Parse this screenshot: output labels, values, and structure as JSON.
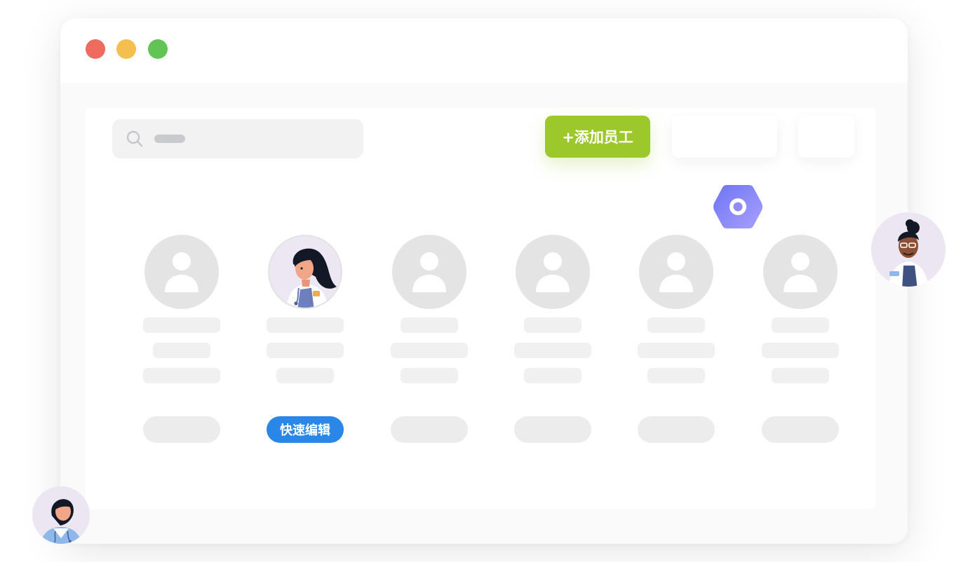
{
  "toolbar": {
    "add_employee_label": "+添加员工"
  },
  "employees": [
    {
      "has_photo": false,
      "button_label": ""
    },
    {
      "has_photo": true,
      "button_label": "快速编辑"
    },
    {
      "has_photo": false,
      "button_label": ""
    },
    {
      "has_photo": false,
      "button_label": ""
    },
    {
      "has_photo": false,
      "button_label": ""
    },
    {
      "has_photo": false,
      "button_label": ""
    }
  ],
  "icons": {
    "search": "search-icon",
    "settings": "hexagon-settings-icon",
    "placeholder_avatar": "user-placeholder-icon"
  },
  "colors": {
    "add_button": "#9dc82c",
    "quick_edit_button": "#2a87e8",
    "settings_badge": "#7b7ff5",
    "traffic_red": "#ef6b5f",
    "traffic_yellow": "#f4bf4f",
    "traffic_green": "#61c454"
  }
}
